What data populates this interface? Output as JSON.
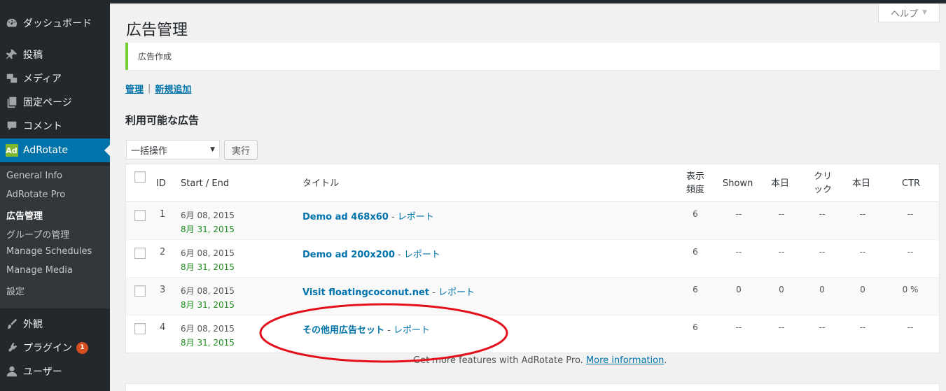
{
  "sidebar": {
    "items": [
      {
        "label": "ダッシュボード",
        "icon": "dashboard-icon"
      },
      {
        "label": "投稿",
        "icon": "pushpin-icon"
      },
      {
        "label": "メディア",
        "icon": "media-icon"
      },
      {
        "label": "固定ページ",
        "icon": "pages-icon"
      },
      {
        "label": "コメント",
        "icon": "comment-icon"
      },
      {
        "label": "AdRotate",
        "icon": "adrotate-logo-icon"
      },
      {
        "label": "外観",
        "icon": "paintbrush-icon"
      },
      {
        "label": "プラグイン",
        "icon": "plugin-icon",
        "badge": "1"
      },
      {
        "label": "ユーザー",
        "icon": "user-icon"
      }
    ],
    "adrotate_logo_text": "Ad",
    "submenu": [
      {
        "label": "General Info"
      },
      {
        "label": "AdRotate Pro"
      },
      {
        "label": "広告管理"
      },
      {
        "label": "グループの管理"
      },
      {
        "label": "Manage Schedules"
      },
      {
        "label": "Manage Media"
      },
      {
        "label": "設定"
      }
    ]
  },
  "help_tab": {
    "label": "ヘルプ"
  },
  "page": {
    "title": "広告管理",
    "notice": "広告作成",
    "subnav": {
      "manage": "管理",
      "separator": "|",
      "add_new": "新規追加"
    },
    "section_title": "利用可能な広告",
    "bulk_action": {
      "selected": "一括操作",
      "apply_label": "実行"
    }
  },
  "table": {
    "headers": {
      "id": "ID",
      "start_end": "Start / End",
      "title": "タイトル",
      "impressions_1": "表示",
      "impressions_2": "頻度",
      "shown": "Shown",
      "today_1": "本日",
      "clicks_1": "クリ",
      "clicks_2": "ック",
      "today_2": "本日",
      "ctr": "CTR"
    },
    "rows": [
      {
        "id": "1",
        "start": "6月 08, 2015",
        "end": "8月 31, 2015",
        "title": "Demo ad 468x60",
        "report": "レポート",
        "impressions": "6",
        "shown": "--",
        "today": "--",
        "clicks": "--",
        "today_clicks": "--",
        "ctr": "--"
      },
      {
        "id": "2",
        "start": "6月 08, 2015",
        "end": "8月 31, 2015",
        "title": "Demo ad 200x200",
        "report": "レポート",
        "impressions": "6",
        "shown": "--",
        "today": "--",
        "clicks": "--",
        "today_clicks": "--",
        "ctr": "--"
      },
      {
        "id": "3",
        "start": "6月 08, 2015",
        "end": "8月 31, 2015",
        "title": "Visit floatingcoconut.net",
        "report": "レポート",
        "impressions": "6",
        "shown": "0",
        "today": "0",
        "clicks": "0",
        "today_clicks": "0",
        "ctr": "0 %"
      },
      {
        "id": "4",
        "start": "6月 08, 2015",
        "end": "8月 31, 2015",
        "title": "その他用広告セット",
        "report": "レポート",
        "impressions": "6",
        "shown": "--",
        "today": "--",
        "clicks": "--",
        "today_clicks": "--",
        "ctr": "--"
      }
    ],
    "report_separator": " - "
  },
  "footer": {
    "text": "Get more features with AdRotate Pro.",
    "link": "More information",
    "period": "."
  },
  "colors": {
    "sidebar_bg": "#23282d",
    "submenu_bg": "#32373c",
    "active_bg": "#0073aa",
    "link": "#0073aa",
    "end_date": "#1e8c1e",
    "notice_border": "#7ad03a",
    "badge": "#d54e21",
    "annotation": "#e3101c"
  }
}
